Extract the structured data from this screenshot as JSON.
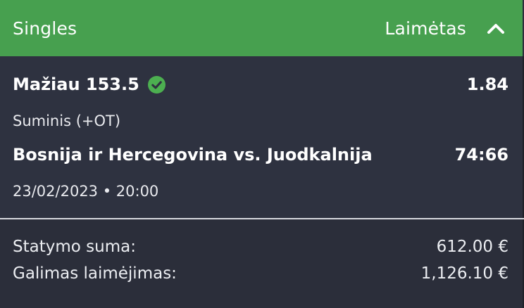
{
  "header": {
    "title": "Singles",
    "status": "Laimėtas",
    "collapse_icon": "chevron-up-icon",
    "color": "#47a04f"
  },
  "selection": {
    "name": "Mažiau 153.5",
    "odds": "1.84",
    "status_icon": "check-circle-icon",
    "status_color": "#4caf50",
    "market": "Suminis (+OT)"
  },
  "event": {
    "name": "Bosnija ir Hercegovina vs. Juodkalnija",
    "score": "74:66",
    "datetime": "23/02/2023 • 20:00"
  },
  "summary": {
    "stake_label": "Statymo suma:",
    "stake_value": "612.00 €",
    "win_label": "Galimas laimėjimas:",
    "win_value": "1,126.10 €"
  }
}
